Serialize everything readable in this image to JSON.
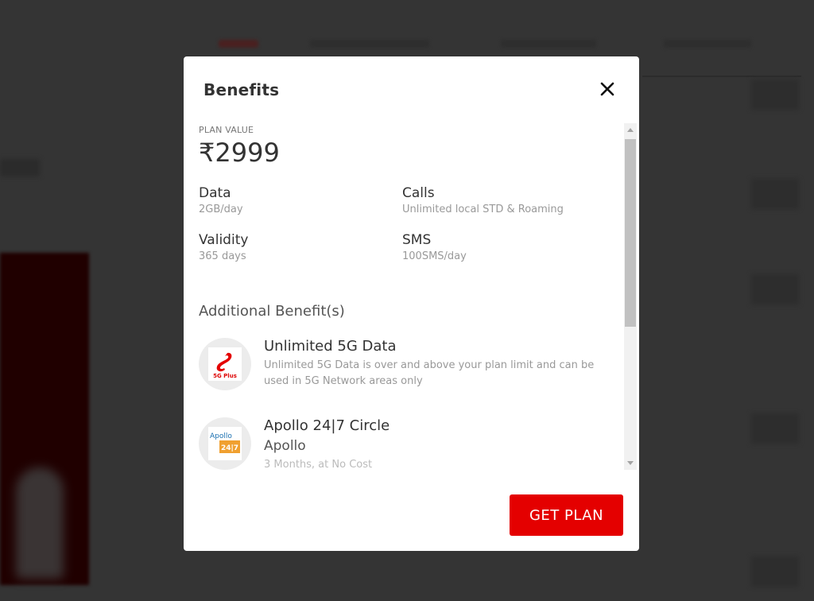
{
  "modal": {
    "title": "Benefits",
    "close_icon": "close-icon",
    "plan_value_label": "PLAN VALUE",
    "plan_value": "₹2999",
    "specs": [
      {
        "label": "Data",
        "value": "2GB/day"
      },
      {
        "label": "Calls",
        "value": "Unlimited local STD & Roaming"
      },
      {
        "label": "Validity",
        "value": "365 days"
      },
      {
        "label": "SMS",
        "value": "100SMS/day"
      }
    ],
    "additional_title": "Additional Benefit(s)",
    "benefits": [
      {
        "icon": "airtel-5g-plus-logo",
        "logo_text": "5G Plus",
        "title": "Unlimited 5G Data",
        "description": "Unlimited 5G Data is over and above your plan limit and can be used in 5G Network areas only"
      },
      {
        "icon": "apollo-247-logo",
        "logo_text_top": "Apollo",
        "logo_text_bottom": "24|7",
        "title": "Apollo 24|7 Circle",
        "subtitle": "Apollo",
        "note": "3 Months, at No Cost"
      }
    ],
    "cta_label": "GET PLAN"
  },
  "colors": {
    "brand_red": "#e40000",
    "overlay": "#333333"
  }
}
